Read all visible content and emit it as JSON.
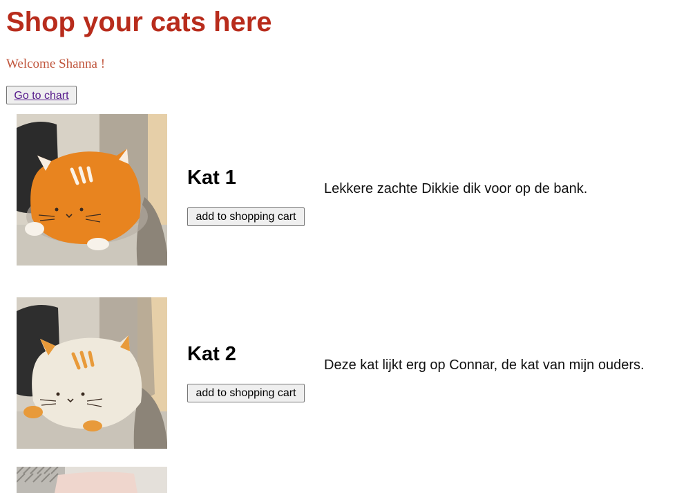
{
  "header": {
    "title": "Shop your cats here",
    "welcome": "Welcome Shanna !",
    "chart_link_label": "Go to chart"
  },
  "products": [
    {
      "name": "Kat 1",
      "button_label": "add to shopping cart",
      "description": "Lekkere zachte Dikkie dik voor op de bank.",
      "image_subject": "orange-cat-plush"
    },
    {
      "name": "Kat 2",
      "button_label": "add to shopping cart",
      "description": "Deze kat lijkt erg op Connar, de kat van mijn ouders.",
      "image_subject": "white-cat-plush"
    },
    {
      "image_subject": "pink-cushion"
    }
  ],
  "colors": {
    "title": "#b82c1c",
    "welcome": "#c0553c",
    "link": "#551a8b"
  }
}
